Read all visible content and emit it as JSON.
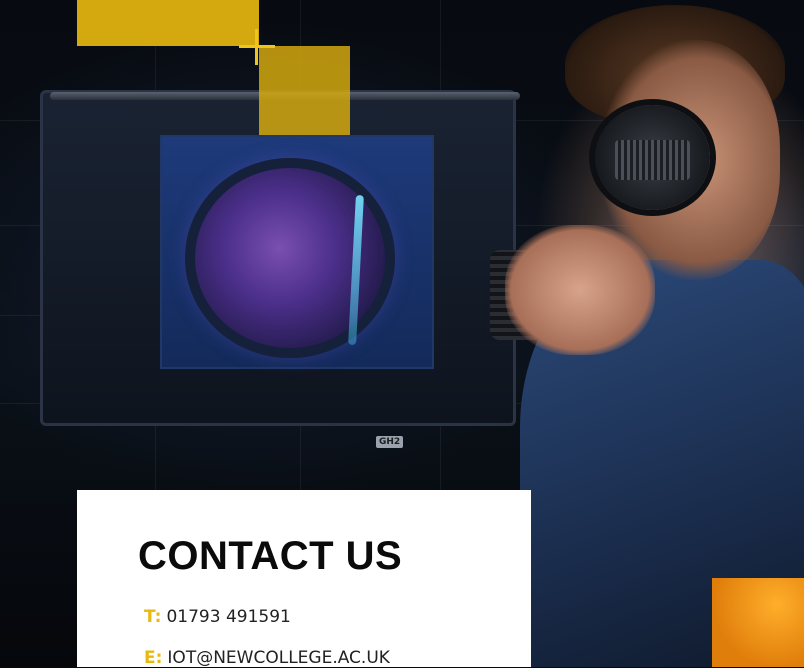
{
  "contact": {
    "title": "CONTACT US",
    "phone_label": "T:",
    "phone": "01793 491591",
    "email_label": "E:",
    "email": "IOT@NEWCOLLEGE.AC.UK"
  },
  "photo": {
    "camera_badge": "GH2"
  },
  "colors": {
    "accent_yellow": "#d4a80f",
    "accent_orange": "#f29a1a",
    "card_bg": "#ffffff",
    "title_text": "#0b0b0b"
  }
}
